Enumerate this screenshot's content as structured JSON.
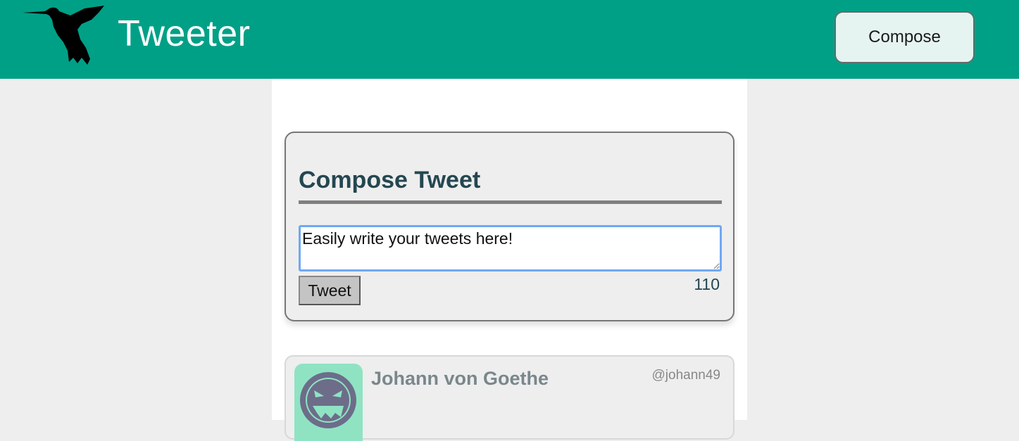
{
  "header": {
    "brand": "Tweeter",
    "compose_label": "Compose",
    "logo_icon": "hummingbird-icon",
    "bg_color": "#00a087"
  },
  "compose": {
    "title": "Compose Tweet",
    "input_value": "Easily write your tweets here!",
    "tweet_label": "Tweet",
    "counter": "110"
  },
  "tweets": [
    {
      "name": "Johann von Goethe",
      "handle": "@johann49",
      "avatar_icon": "devil-face-avatar-icon",
      "avatar_color": "#8fe3c3"
    }
  ]
}
